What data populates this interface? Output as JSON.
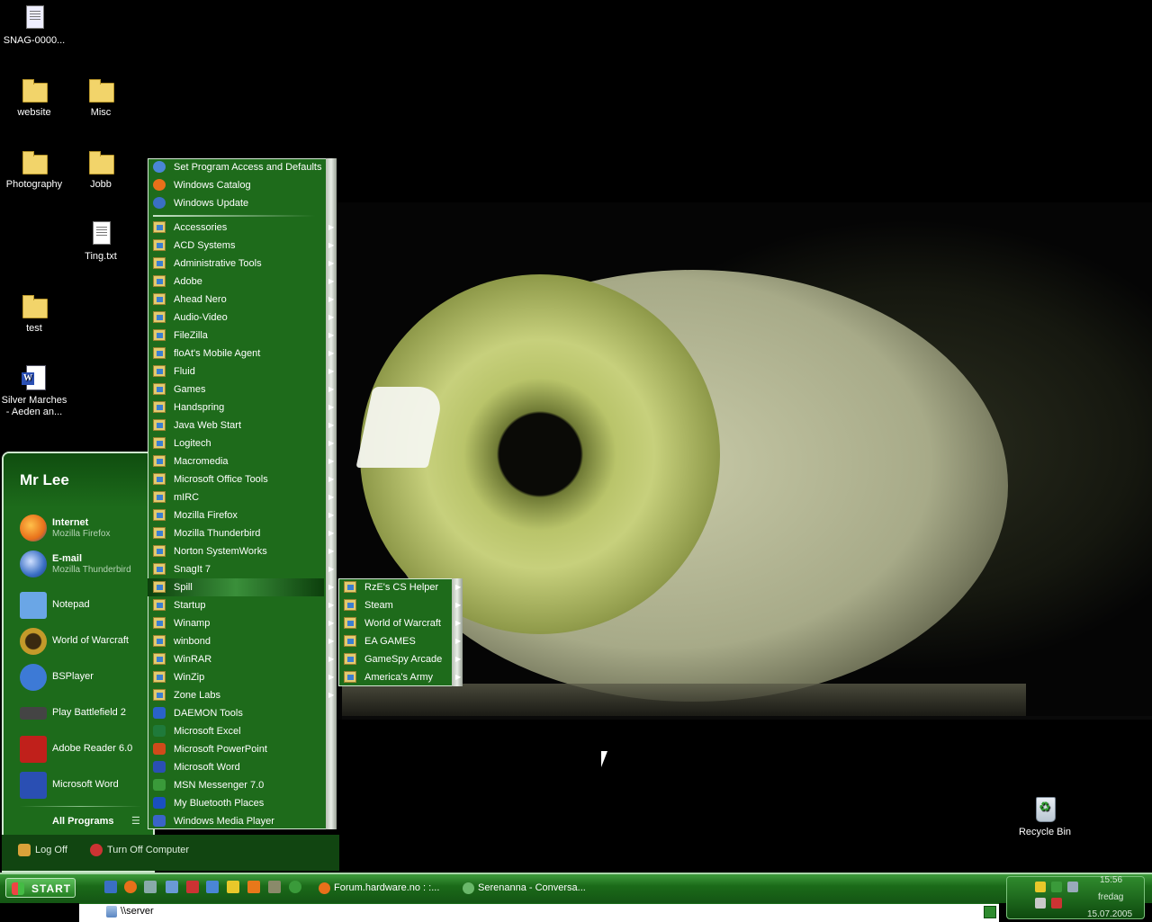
{
  "desktop": {
    "icons": [
      {
        "label": "SNAG-0000..."
      },
      {
        "label": "website"
      },
      {
        "label": "Misc"
      },
      {
        "label": "Photography"
      },
      {
        "label": "Jobb"
      },
      {
        "label": "Ting.txt"
      },
      {
        "label": "test"
      },
      {
        "label": "Silver Marches - Aeden an..."
      },
      {
        "label": "Recycle Bin"
      }
    ]
  },
  "start_menu": {
    "user_name": "Mr Lee",
    "pinned": [
      {
        "title": "Internet",
        "subtitle": "Mozilla Firefox",
        "icon": "firefox-icon",
        "color": "#e8701a"
      },
      {
        "title": "E-mail",
        "subtitle": "Mozilla Thunderbird",
        "icon": "thunderbird-icon",
        "color": "#3a6fc4"
      }
    ],
    "recent": [
      {
        "label": "Notepad",
        "icon": "notepad-icon",
        "color": "#6aa6e6"
      },
      {
        "label": "World of Warcraft",
        "icon": "warcraft-icon",
        "color": "#c49a2a"
      },
      {
        "label": "BSPlayer",
        "icon": "bsplayer-icon",
        "color": "#3d7ad6"
      },
      {
        "label": "Play Battlefield 2",
        "icon": "battlefield-icon",
        "color": "#444444"
      },
      {
        "label": "Adobe Reader 6.0",
        "icon": "adobe-reader-icon",
        "color": "#c0201b"
      },
      {
        "label": "Microsoft Word",
        "icon": "word-icon",
        "color": "#2a4fb3"
      }
    ],
    "all_programs": "All Programs",
    "log_off": "Log Off",
    "turn_off": "Turn Off Computer"
  },
  "programs_menu": {
    "top_items": [
      "Set Program Access and Defaults",
      "Windows Catalog",
      "Windows Update"
    ],
    "folders": [
      "Accessories",
      "ACD Systems",
      "Administrative Tools",
      "Adobe",
      "Ahead Nero",
      "Audio-Video",
      "FileZilla",
      "floAt's Mobile Agent",
      "Fluid",
      "Games",
      "Handspring",
      "Java Web Start",
      "Logitech",
      "Macromedia",
      "Microsoft Office Tools",
      "mIRC",
      "Mozilla Firefox",
      "Mozilla Thunderbird",
      "Norton SystemWorks",
      "SnagIt 7",
      "Spill",
      "Startup",
      "Winamp",
      "winbond",
      "WinRAR",
      "WinZip",
      "Zone Labs"
    ],
    "apps": [
      {
        "label": "DAEMON Tools",
        "icon": "daemon-tools-icon",
        "color": "#2a62c8"
      },
      {
        "label": "Microsoft Excel",
        "icon": "excel-icon",
        "color": "#1f7a3a"
      },
      {
        "label": "Microsoft PowerPoint",
        "icon": "powerpoint-icon",
        "color": "#d04a1a"
      },
      {
        "label": "Microsoft Word",
        "icon": "word-icon",
        "color": "#2a4fb3"
      },
      {
        "label": "MSN Messenger 7.0",
        "icon": "msn-icon",
        "color": "#3a9a3a"
      },
      {
        "label": "My Bluetooth Places",
        "icon": "bluetooth-icon",
        "color": "#1a4fc0"
      },
      {
        "label": "Windows Media Player",
        "icon": "media-player-icon",
        "color": "#3a64c8"
      }
    ],
    "highlighted": "Spill"
  },
  "spill_submenu": {
    "items": [
      "RzE's CS Helper",
      "Steam",
      "World of Warcraft",
      "EA GAMES",
      "GameSpy Arcade",
      "America's Army"
    ]
  },
  "taskbar": {
    "start_label": "START",
    "windows": [
      {
        "label": "Forum.hardware.no : :...",
        "icon": "firefox-icon"
      },
      {
        "label": "Serenanna - Conversa...",
        "icon": "msn-icon"
      }
    ],
    "clock": {
      "time": "15:56",
      "day": "fredag",
      "date": "15.07.2005"
    }
  },
  "address_bar": {
    "value": "\\\\server"
  }
}
